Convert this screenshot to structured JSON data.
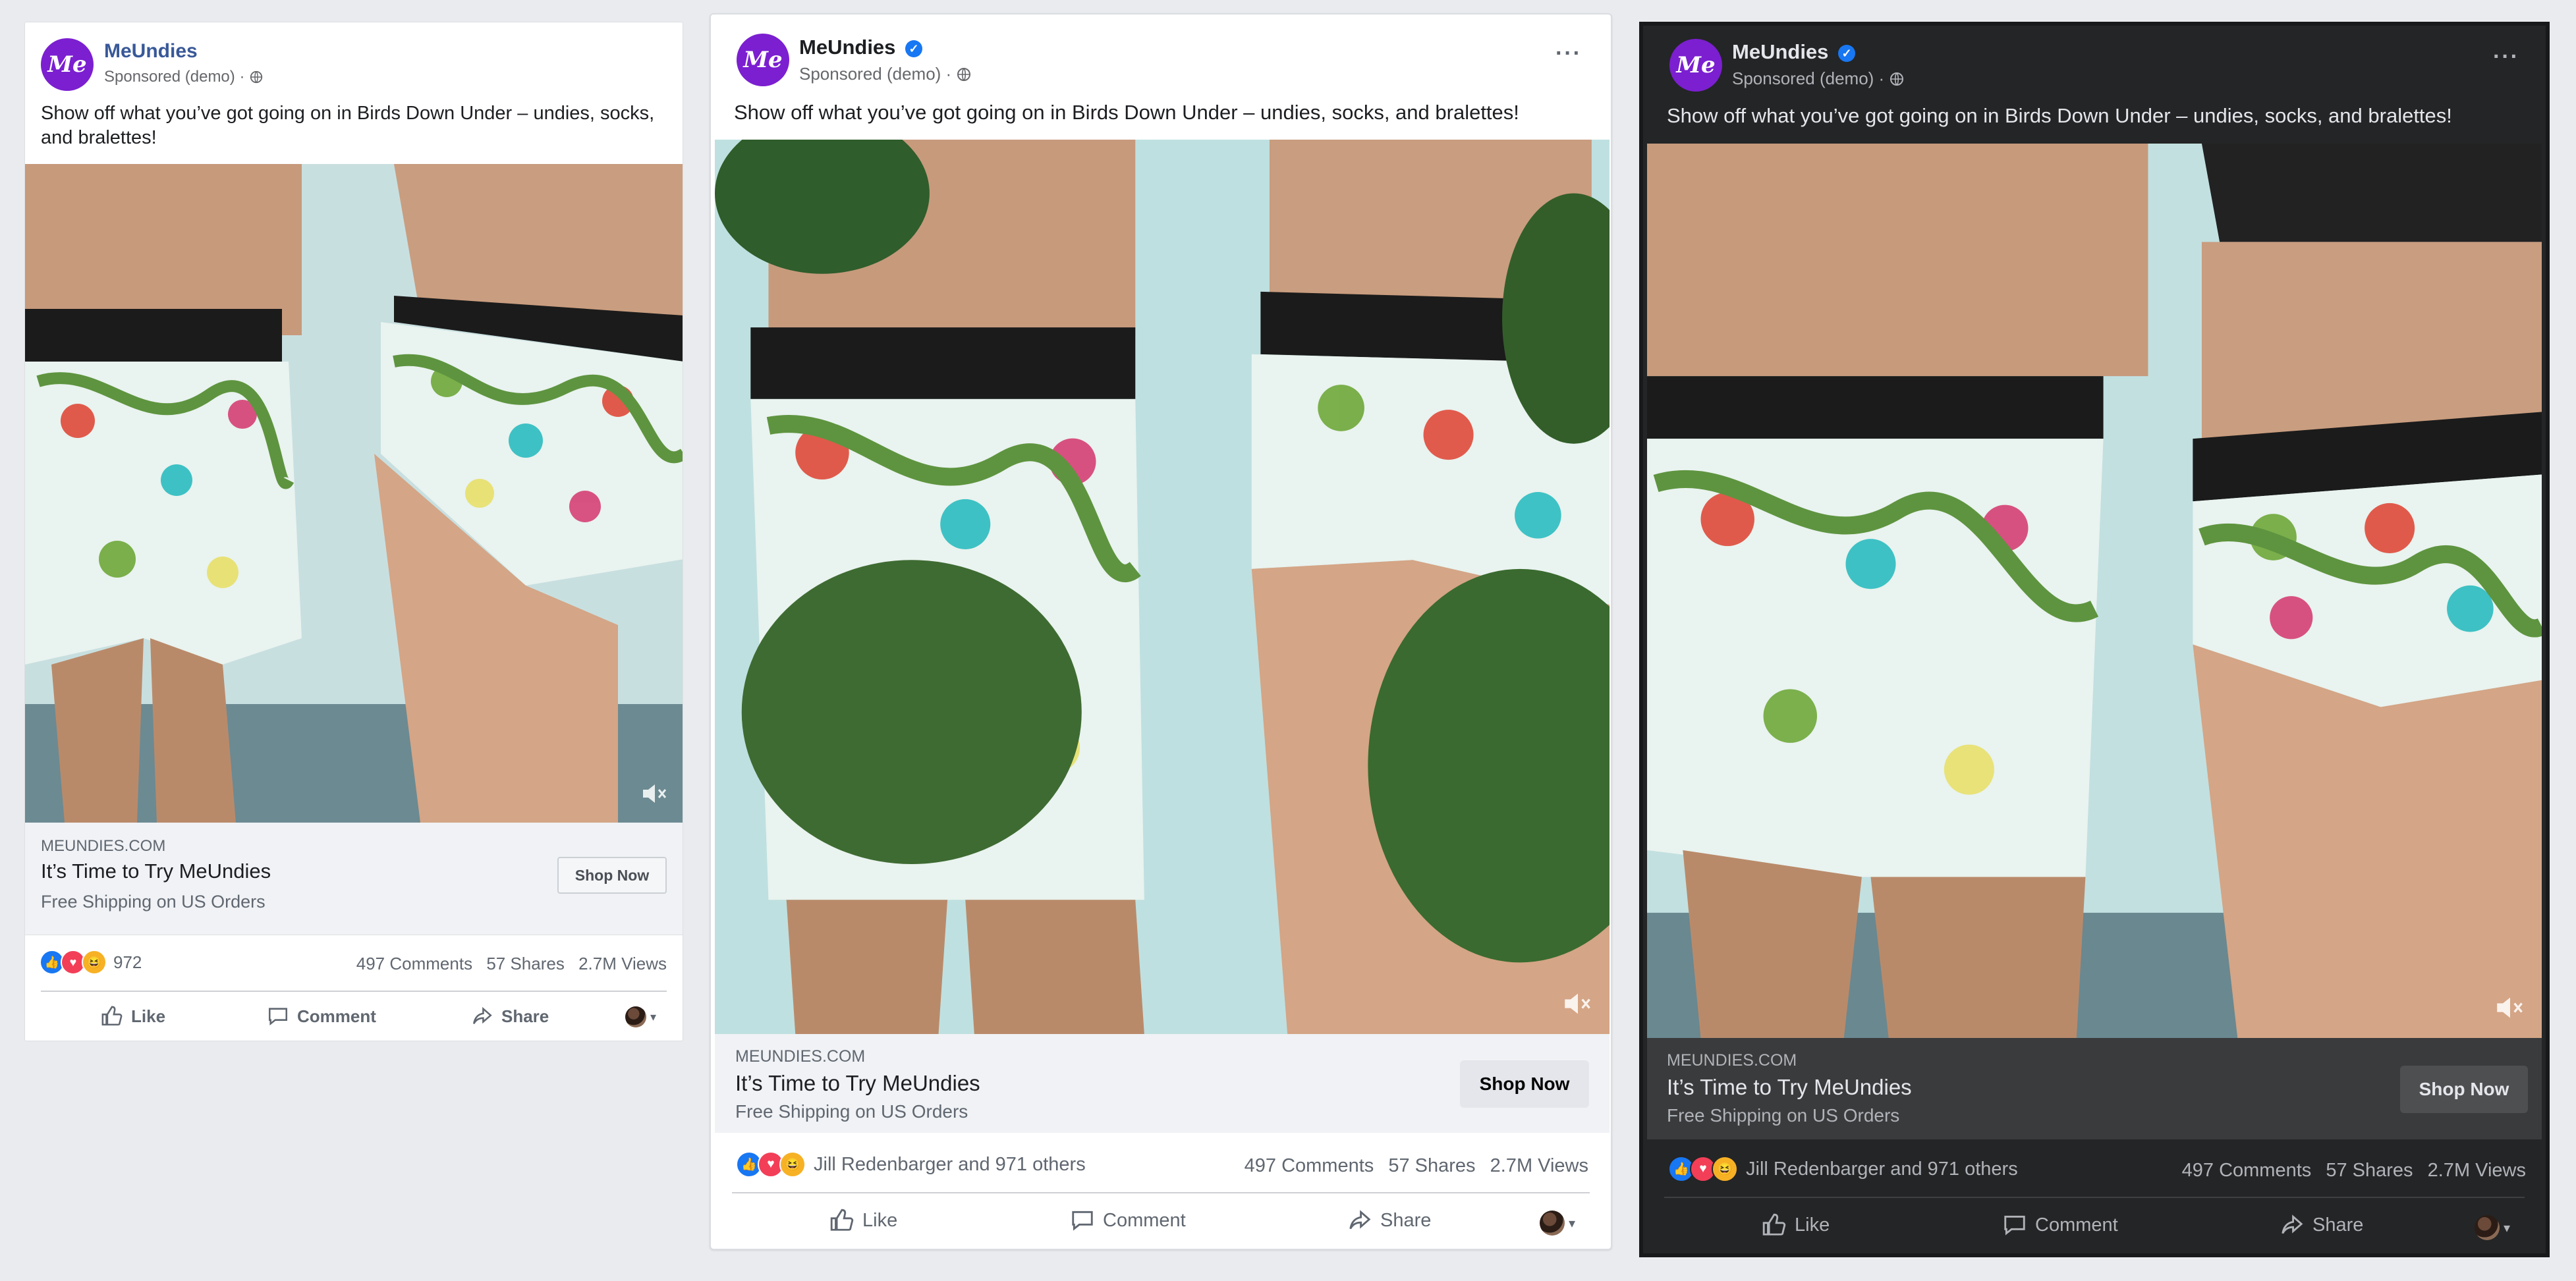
{
  "cards": [
    {
      "variant": "classic",
      "brand": "MeUndies",
      "avatar_text": "Me",
      "sponsored": "Sponsored (demo) ·",
      "caption": "Show off what you’ve got going on in Birds Down Under – undies, socks, and bralettes!",
      "link": {
        "domain": "MEUNDIES.COM",
        "headline": "It’s Time to Try MeUndies",
        "description": "Free Shipping on US Orders",
        "cta": "Shop Now"
      },
      "reactions_count": "972",
      "comments": "497 Comments",
      "shares": "57 Shares",
      "views": "2.7M Views",
      "actions": {
        "like": "Like",
        "comment": "Comment",
        "share": "Share"
      }
    },
    {
      "variant": "new-light",
      "brand": "MeUndies",
      "avatar_text": "Me",
      "sponsored": "Sponsored (demo) ·",
      "caption": "Show off what you’ve got going on in Birds Down Under – undies, socks, and bralettes!",
      "link": {
        "domain": "MEUNDIES.COM",
        "headline": "It’s Time to Try MeUndies",
        "description": "Free Shipping on US Orders",
        "cta": "Shop Now"
      },
      "reactions_count": "Jill Redenbarger and 971 others",
      "comments": "497 Comments",
      "shares": "57 Shares",
      "views": "2.7M Views",
      "actions": {
        "like": "Like",
        "comment": "Comment",
        "share": "Share"
      }
    },
    {
      "variant": "new-dark",
      "brand": "MeUndies",
      "avatar_text": "Me",
      "sponsored": "Sponsored (demo) ·",
      "caption": "Show off what you’ve got going on in Birds Down Under – undies, socks, and bralettes!",
      "link": {
        "domain": "MEUNDIES.COM",
        "headline": "It’s Time to Try MeUndies",
        "description": "Free Shipping on US Orders",
        "cta": "Shop Now"
      },
      "reactions_count": "Jill Redenbarger and 971 others",
      "comments": "497 Comments",
      "shares": "57 Shares",
      "views": "2.7M Views",
      "actions": {
        "like": "Like",
        "comment": "Comment",
        "share": "Share"
      }
    }
  ],
  "colors": {
    "page_bg": "#e9ebee",
    "brand_purple": "#7b1fd0",
    "classic_brand_link": "#385898",
    "dark_card": "#242526"
  }
}
